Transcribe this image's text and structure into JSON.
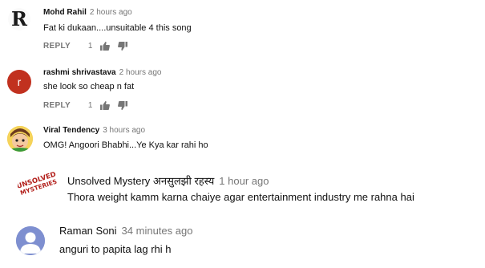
{
  "comments": [
    {
      "author": "Mohd Rahil",
      "time": "2 hours ago",
      "text": "Fat ki dukaan....unsuitable 4 this song",
      "reply_label": "REPLY",
      "likes": "1",
      "avatar_letter": "R",
      "avatar_icon": "gothic-r-logo-icon"
    },
    {
      "author": "rashmi shrivastava",
      "time": "2 hours ago",
      "text": "she look so  cheap n fat",
      "reply_label": "REPLY",
      "likes": "1",
      "avatar_letter": "r",
      "avatar_color": "#c1311f"
    },
    {
      "author": "Viral Tendency",
      "time": "3 hours ago",
      "text": "OMG! Angoori Bhabhi...Ye Kya kar rahi ho",
      "avatar_icon": "cartoon-face-avatar-icon"
    },
    {
      "author": "Unsolved Mystery अनसुलझी रहस्य",
      "time": "1 hour ago",
      "text": "Thora weight kamm karna chaiye agar entertainment industry me rahna hai",
      "avatar_logo_line1": "UNSOLVED",
      "avatar_logo_line2": "MYSTERIES"
    },
    {
      "author": "Raman Soni",
      "time": "34 minutes ago",
      "text": "anguri to papita lag rhi h",
      "avatar_icon": "default-user-avatar-icon",
      "avatar_color": "#7e8fd0"
    }
  ],
  "colors": {
    "secondary_text": "#767676",
    "primary_text": "#111111"
  }
}
